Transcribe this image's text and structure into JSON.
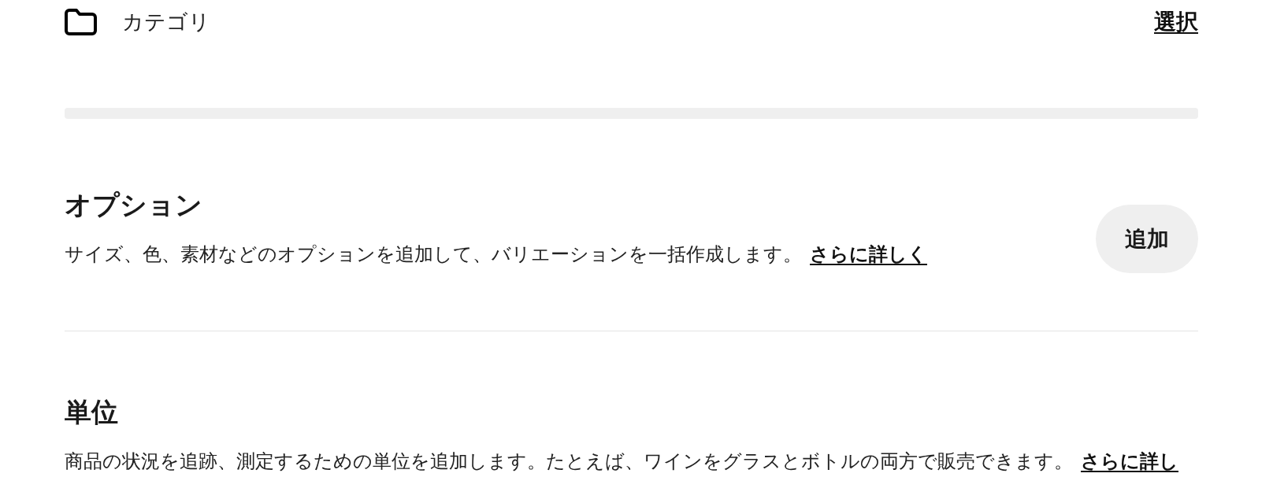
{
  "category_row": {
    "label": "カテゴリ",
    "action": "選択"
  },
  "sections": [
    {
      "title": "オプション",
      "description": "サイズ、色、素材などのオプションを追加して、バリエーションを一括作成します。",
      "link": "さらに詳しく",
      "button": "追加"
    },
    {
      "title": "単位",
      "description": "商品の状況を追跡、測定するための単位を追加します。たとえば、ワインをグラスとボトルの両方で販売できます。",
      "link": "さらに詳し"
    }
  ]
}
